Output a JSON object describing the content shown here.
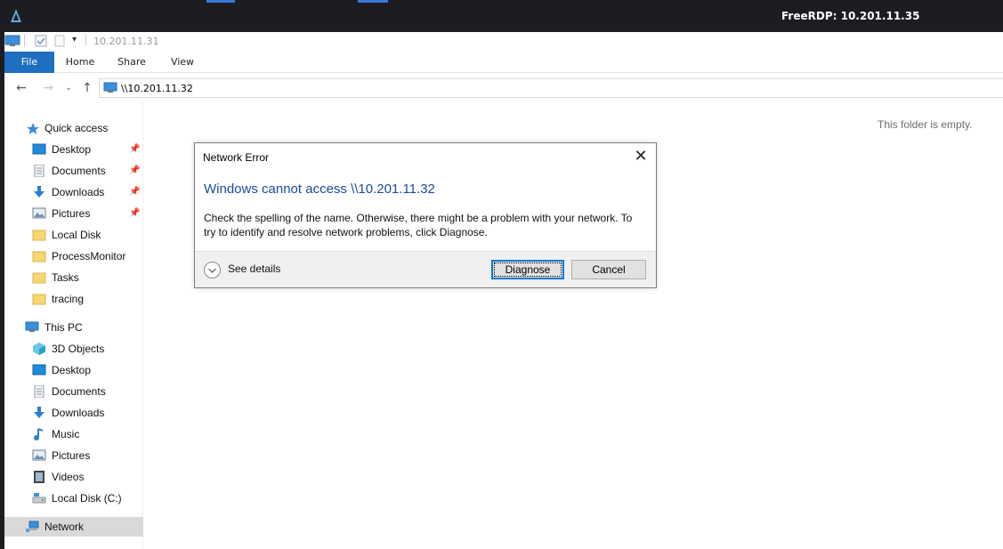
{
  "rdp": {
    "title": "FreeRDP: 10.201.11.35"
  },
  "quick_access_toolbar": {
    "window_title": "10.201.11.31"
  },
  "ribbon": {
    "tabs": [
      "File",
      "Home",
      "Share",
      "View"
    ]
  },
  "address_bar": {
    "path": "\\\\10.201.11.32"
  },
  "navigation": {
    "quick_access_label": "Quick access",
    "quick_access_items": [
      {
        "label": "Desktop",
        "icon": "desktop-icon",
        "pinned": true
      },
      {
        "label": "Documents",
        "icon": "documents-icon",
        "pinned": true
      },
      {
        "label": "Downloads",
        "icon": "downloads-icon",
        "pinned": true
      },
      {
        "label": "Pictures",
        "icon": "pictures-icon",
        "pinned": true
      },
      {
        "label": "Local Disk",
        "icon": "folder-icon",
        "pinned": false
      },
      {
        "label": "ProcessMonitor",
        "icon": "folder-icon",
        "pinned": false
      },
      {
        "label": "Tasks",
        "icon": "folder-icon",
        "pinned": false
      },
      {
        "label": "tracing",
        "icon": "folder-icon",
        "pinned": false
      }
    ],
    "this_pc_label": "This PC",
    "this_pc_items": [
      {
        "label": "3D Objects",
        "icon": "3d-objects-icon"
      },
      {
        "label": "Desktop",
        "icon": "desktop-icon"
      },
      {
        "label": "Documents",
        "icon": "documents-icon"
      },
      {
        "label": "Downloads",
        "icon": "downloads-icon"
      },
      {
        "label": "Music",
        "icon": "music-icon"
      },
      {
        "label": "Pictures",
        "icon": "pictures-icon"
      },
      {
        "label": "Videos",
        "icon": "videos-icon"
      },
      {
        "label": "Local Disk (C:)",
        "icon": "drive-icon"
      }
    ],
    "network_label": "Network"
  },
  "content": {
    "empty_message": "This folder is empty."
  },
  "dialog": {
    "title": "Network Error",
    "heading": "Windows cannot access \\\\10.201.11.32",
    "body_line1": "Check the spelling of the name. Otherwise, there might be a problem with your network. To",
    "body_line2": "try to identify and resolve network problems, click Diagnose.",
    "see_details": "See details",
    "diagnose": "Diagnose",
    "cancel": "Cancel"
  },
  "colors": {
    "accent": "#1e6fc0",
    "heading": "#1a4a9b",
    "rdp_bar": "#1b1d22",
    "selection": "#d9d9d9"
  }
}
